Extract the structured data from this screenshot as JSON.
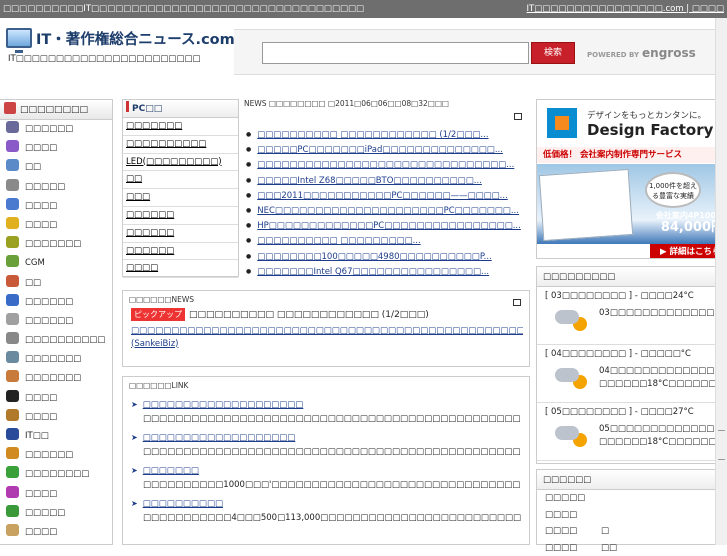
{
  "topbar": {
    "left_text": "□□□□□□□□□□IT□□□□□□□□□□□□□□□□□□□□□□□□□□□□□□□□□□",
    "right_text": "IT□□□□□□□□□□□□□□□□.com | □□□□"
  },
  "logo": {
    "title": "IT・著作権総合ニュース.com",
    "tagline": "IT□□□□□□□□□□□□□□□□□□□□□□□"
  },
  "search": {
    "value": "",
    "button_label": "検索",
    "powered_by": "POWERED BY",
    "powered_brand": "engross"
  },
  "sidebar": {
    "heading": "□□□□□□□□",
    "items": [
      {
        "label": "□□□□□□",
        "color": "#6a6a9a"
      },
      {
        "label": "□□□□",
        "color": "#8a5ac8"
      },
      {
        "label": "□□",
        "color": "#5a8ac8"
      },
      {
        "label": "□□□□□",
        "color": "#8a8a8a"
      },
      {
        "label": "□□□□",
        "color": "#4a7ad0"
      },
      {
        "label": "□□□□",
        "color": "#e0b020"
      },
      {
        "label": "□□□□□□□",
        "color": "#9aa020"
      },
      {
        "label": "CGM",
        "color": "#6aa03a"
      },
      {
        "label": "□□",
        "color": "#c85a3a"
      },
      {
        "label": "□□□□□□",
        "color": "#3a6ac8"
      },
      {
        "label": "□□□□□□",
        "color": "#a0a0a0"
      },
      {
        "label": "□□□□□□□□□□",
        "color": "#888888"
      },
      {
        "label": "□□□□□□□",
        "color": "#6a8aa0"
      },
      {
        "label": "□□□□□□□",
        "color": "#c87a3a"
      },
      {
        "label": "□□□□",
        "color": "#222222"
      },
      {
        "label": "□□□□",
        "color": "#b07a2a"
      },
      {
        "label": "IT□□",
        "color": "#2a4a9a"
      },
      {
        "label": "□□□□□□",
        "color": "#d08a20"
      },
      {
        "label": "□□□□□□□□",
        "color": "#3aa03a"
      },
      {
        "label": "□□□□",
        "color": "#b03ab0"
      },
      {
        "label": "□□□□□",
        "color": "#3a9a3a"
      },
      {
        "label": "□□□□",
        "color": "#c8a060"
      }
    ]
  },
  "pc_menu": {
    "heading": "PC□□",
    "items": [
      "□□□□□□□",
      "□□□□□□□□□□",
      "LED(□□□□□□□□□)",
      "□□",
      "□□□",
      "□□□□□□",
      "□□□□□□",
      "□□□□□□",
      "□□□□"
    ]
  },
  "news": {
    "header": "NEWS □□□□□□□□ □2011□06□06□□08□32□□□",
    "items": [
      "□□□□□□□□□□ □□□□□□□□□□□□ (1/2□□□...",
      "□□□□□PC□□□□□□□iPad□□□□□□□□□□□□□□...",
      "□□□□□□□□□□□□□□□□□□□□□□□□□□□□□□□...",
      "□□□□□Intel Z68□□□□□BTO□□□□□□□□□□...",
      "□□□2011□□□□□□□□□□□PC□□□□□□——□□□□...",
      "NEC□□□□□□□□□□□□□□□□□□□□□PC□□□□□□□...",
      "HP□□□□□□□□□□□□□PC□□□□□□□□□□□□□□□□...",
      "□□□□□□□□□□ □□□□□□□□□...",
      "□□□□□□□□100□□□□□4980□□□□□□□□□□P...",
      "□□□□□□□Intel Q67□□□□□□□□□□□□□□□□..."
    ]
  },
  "pickup": {
    "header": "□□□□□□NEWS",
    "tag": "ピックアップ",
    "title": "□□□□□□□□□□ □□□□□□□□□□□□ (1/2□□□)",
    "desc": "□□□□□□□□□□□□□□□□□□□□□□□□□□□□□□□□□□□□□□□□□□□□□□□□□□□□□□□□□□□□□□□□□□□□□□□□□□□□□□□□□□□□□□□□□□□□□□□□□□□□□□□□□□□□□□□□□□□□□□□□□□□□□□□□□□□□□□□□□□□□□□□□□□□□□□…(SankeiBiz)"
  },
  "links": {
    "header": "□□□□□□LINK",
    "items": [
      {
        "title": "□□□□□□□□□□□□□□□□□□□□",
        "desc": "□□□□□□□□□□□□□□□□□□□□□□□□□□□□□□□□□□□□□□□□□□□□□□□□□□□□□□□□□□□□□□"
      },
      {
        "title": "□□□□□□□□□□□□□□□□□□□",
        "desc": "□□□□□□□□□□□□□□□□□□□□□□□□□□□□□□□□□□□□□□□□□□□□□□□□□□□□□□□□□□□□□□□"
      },
      {
        "title": "□□□□□□□",
        "desc": "□□□□□□□□□□1000□□□'□□□□□□□□□□□□□□□□□□□□□□□□□□□□□□□□□□□□□"
      },
      {
        "title": "□□□□□□□□□□",
        "desc": "□□□□□□□□□□□4□□□500□113,000□□□□□□□□□□□□□□□□□□□□□□□□□□□□□□□□□□□□□□□"
      }
    ]
  },
  "ad": {
    "tagline": "デザインをもっとカンタンに。",
    "brand": "Design Factory",
    "promo": "低価格！ 会社案内制作専門サービス",
    "bubble": "1,000件を超える豊富な実績",
    "price_label": "会社案内4P100部",
    "price": "84,000円",
    "detail_button": "▶ 詳細はこちら"
  },
  "weather": {
    "heading": "□□□□□□□□□",
    "days": [
      {
        "label": "[ 03□□□□□□□□ ] - □□□□24°C",
        "text": "03□□□□□□□□□□□□□□□□□□□□□15°C□□□□□□"
      },
      {
        "label": "[ 04□□□□□□□□ ] - □□□□□°C",
        "text": "04□□□□□□□□□□□□□□□□□□□□□26°C □□□□□□18°C□□□□□□□"
      },
      {
        "label": "[ 05□□□□□□□□ ] - □□□□27°C",
        "text": "05□□□□□□□□□□□□□□□□□□□□□27°C □□□□□□18°C□□□□□□□"
      }
    ]
  },
  "stats": {
    "heading": "□□□□□□",
    "rows": [
      {
        "label": "□□□□□",
        "value": ""
      },
      {
        "label": "□□□□",
        "value": ""
      },
      {
        "label": "□□□□",
        "value": "□"
      },
      {
        "label": "□□□□",
        "value": "□□"
      }
    ]
  }
}
